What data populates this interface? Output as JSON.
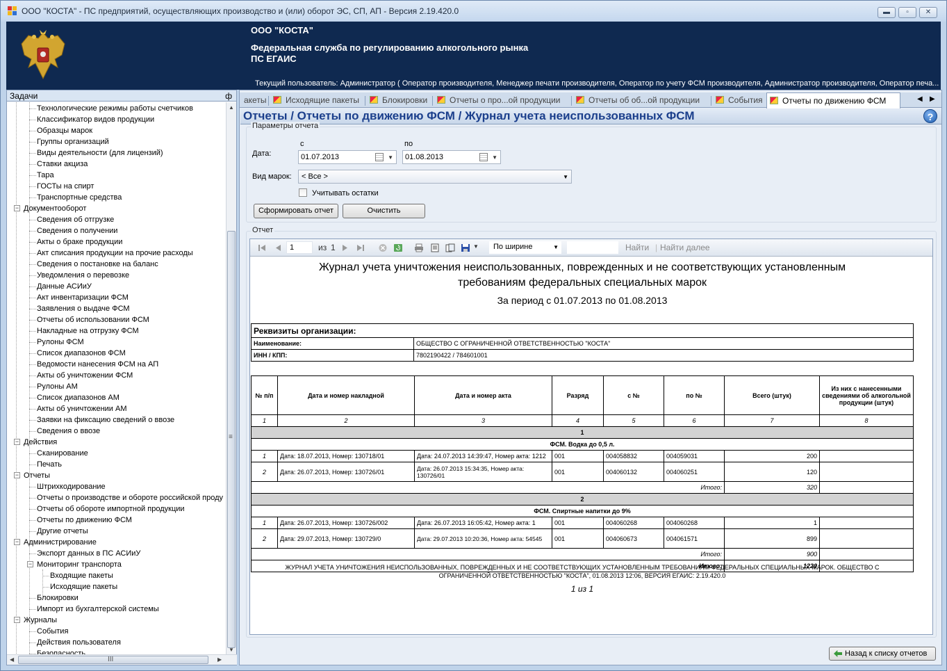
{
  "window": {
    "title": "ООО \"КОСТА\" - ПС предприятий, осуществляющих производство и (или) оборот ЭС, СП, АП - Версия 2.19.420.0",
    "controls": {
      "minimize": "▬",
      "maximize": "▫",
      "close": "✕"
    }
  },
  "banner": {
    "company": "ООО \"КОСТА\"",
    "service": "Федеральная служба по регулированию алкогольного рынка",
    "system": "ПС ЕГАИС",
    "current_user": "Текущий пользователь: Администратор ( Оператор производителя, Менеджер печати производителя, Оператор по учету ФСМ производителя, Администратор производителя, Оператор печа..."
  },
  "tasks_panel": {
    "title": "Задачи",
    "pin": "ф",
    "items": [
      {
        "label": "Технологические режимы работы счетчиков",
        "level": 2
      },
      {
        "label": "Классификатор видов продукции",
        "level": 2
      },
      {
        "label": "Образцы марок",
        "level": 2
      },
      {
        "label": "Группы организаций",
        "level": 2
      },
      {
        "label": "Виды деятельности (для лицензий)",
        "level": 2
      },
      {
        "label": "Ставки акциза",
        "level": 2
      },
      {
        "label": "Тара",
        "level": 2
      },
      {
        "label": "ГОСТы на спирт",
        "level": 2
      },
      {
        "label": "Транспортные средства",
        "level": 2
      },
      {
        "label": "Документооборот",
        "level": 1,
        "toggle": "−"
      },
      {
        "label": "Сведения об отгрузке",
        "level": 2
      },
      {
        "label": "Сведения о получении",
        "level": 2
      },
      {
        "label": "Акты о браке продукции",
        "level": 2
      },
      {
        "label": "Акт списания продукции на прочие расходы",
        "level": 2
      },
      {
        "label": "Сведения о постановке на баланс",
        "level": 2
      },
      {
        "label": "Уведомления о перевозке",
        "level": 2
      },
      {
        "label": "Данные АСИиУ",
        "level": 2
      },
      {
        "label": "Акт инвентаризации ФСМ",
        "level": 2
      },
      {
        "label": "Заявления о выдаче ФСМ",
        "level": 2
      },
      {
        "label": "Отчеты об использовании ФСМ",
        "level": 2
      },
      {
        "label": "Накладные на отгрузку ФСМ",
        "level": 2
      },
      {
        "label": "Рулоны ФСМ",
        "level": 2
      },
      {
        "label": "Список диапазонов ФСМ",
        "level": 2
      },
      {
        "label": "Ведомости нанесения ФСМ на АП",
        "level": 2
      },
      {
        "label": "Акты об уничтожении ФСМ",
        "level": 2
      },
      {
        "label": "Рулоны АМ",
        "level": 2
      },
      {
        "label": "Список диапазонов АМ",
        "level": 2
      },
      {
        "label": "Акты об уничтожении АМ",
        "level": 2
      },
      {
        "label": "Заявки на фиксацию сведений о ввозе",
        "level": 2
      },
      {
        "label": "Сведения о ввозе",
        "level": 2
      },
      {
        "label": "Действия",
        "level": 1,
        "toggle": "−"
      },
      {
        "label": "Сканирование",
        "level": 2
      },
      {
        "label": "Печать",
        "level": 2
      },
      {
        "label": "Отчеты",
        "level": 1,
        "toggle": "−"
      },
      {
        "label": "Штрихкодирование",
        "level": 2
      },
      {
        "label": "Отчеты о производстве и обороте российской проду",
        "level": 2
      },
      {
        "label": "Отчеты об обороте импортной продукции",
        "level": 2
      },
      {
        "label": "Отчеты по движению ФСМ",
        "level": 2
      },
      {
        "label": "Другие отчеты",
        "level": 2
      },
      {
        "label": "Администрирование",
        "level": 1,
        "toggle": "−"
      },
      {
        "label": "Экспорт данных в ПС АСИиУ",
        "level": 2
      },
      {
        "label": "Мониторинг транспорта",
        "level": 2,
        "toggle": "−"
      },
      {
        "label": "Входящие пакеты",
        "level": 3
      },
      {
        "label": "Исходящие пакеты",
        "level": 3
      },
      {
        "label": "Блокировки",
        "level": 2
      },
      {
        "label": "Импорт из бухгалтерской системы",
        "level": 2
      },
      {
        "label": "Журналы",
        "level": 1,
        "toggle": "−"
      },
      {
        "label": "События",
        "level": 2
      },
      {
        "label": "Действия пользователя",
        "level": 2
      },
      {
        "label": "Безопасность",
        "level": 2
      }
    ],
    "hscroll_grip": "III",
    "vscroll_grip": "≡"
  },
  "tabs": [
    {
      "label": "акеты",
      "icon": false
    },
    {
      "label": "Исходящие пакеты",
      "icon": true
    },
    {
      "label": "Блокировки",
      "icon": true
    },
    {
      "label": "Отчеты о про...ой продукции",
      "icon": true
    },
    {
      "label": "Отчеты об об...ой продукции",
      "icon": true
    },
    {
      "label": "События",
      "icon": true
    },
    {
      "label": "Отчеты по движению ФСМ",
      "icon": true,
      "active": true
    }
  ],
  "tab_nav": {
    "prev": "◀",
    "next": "▶"
  },
  "heading": {
    "title": "Отчеты / Отчеты по движению ФСМ / Журнал учета неиспользованных ФСМ",
    "help": "?"
  },
  "params": {
    "legend": "Параметры отчета",
    "date_label": "Дата:",
    "from_label": "с",
    "to_label": "по",
    "from_value": "01.07.2013",
    "to_value": "01.08.2013",
    "mark_type_label": "Вид марок:",
    "mark_type_value": "< Все >",
    "include_balance_label": "Учитывать остатки",
    "generate_button": "Сформировать отчет",
    "clear_button": "Очистить"
  },
  "report": {
    "legend": "Отчет",
    "toolbar": {
      "page_value": "1",
      "page_of": "из",
      "page_total": "1",
      "zoom_value": "По ширине",
      "find": "Найти",
      "find_next": "Найти далее"
    },
    "doc": {
      "title_line1": "Журнал учета уничтожения неиспользованных, поврежденных и не соответствующих установленным",
      "title_line2": "требованиям федеральных специальных марок",
      "period": "За период с 01.07.2013 по 01.08.2013",
      "org_header": "Реквизиты организации:",
      "name_label": "Наименование:",
      "name_value": "ОБЩЕСТВО С ОГРАНИЧЕННОЙ ОТВЕТСТВЕННОСТЬЮ \"КОСТА\"",
      "inn_label": "ИНН /  КПП:",
      "inn_value": "7802190422  /  784601001",
      "columns": [
        "№ п/п",
        "Дата и номер накладной",
        "Дата и номер акта",
        "Разряд",
        "с №",
        "по №",
        "Всего (штук)",
        "Из них с нанесенными сведениями об алкогольной продукции (штук)"
      ],
      "column_numbers": [
        "1",
        "2",
        "3",
        "4",
        "5",
        "6",
        "7",
        "8"
      ],
      "groups": [
        {
          "rank": "1",
          "category": "ФСМ. Водка до 0,5 л.",
          "rows": [
            {
              "n": "1",
              "invoice": "Дата: 18.07.2013, Номер: 130718/01",
              "act": "Дата: 24.07.2013 14:39:47, Номер акта: 1212",
              "grade": "001",
              "from": "004058832",
              "to": "004059031",
              "total": "200",
              "applied": ""
            },
            {
              "n": "2",
              "invoice": "Дата: 26.07.2013, Номер: 130726/01",
              "act": "Дата: 26.07.2013 15:34:35, Номер акта: 130726/01",
              "grade": "001",
              "from": "004060132",
              "to": "004060251",
              "total": "120",
              "applied": ""
            }
          ],
          "subtotal_label": "Итого:",
          "subtotal": "320"
        },
        {
          "rank": "2",
          "category": "ФСМ. Спиртные напитки до 9%",
          "rows": [
            {
              "n": "1",
              "invoice": "Дата: 26.07.2013, Номер: 130726/002",
              "act": "Дата: 26.07.2013 16:05:42, Номер акта: 1",
              "grade": "001",
              "from": "004060268",
              "to": "004060268",
              "total": "1",
              "applied": ""
            },
            {
              "n": "2",
              "invoice": "Дата: 29.07.2013, Номер: 130729/0",
              "act": "Дата: 29.07.2013 10:20:36, Номер акта: 54545",
              "grade": "001",
              "from": "004060673",
              "to": "004061571",
              "total": "899",
              "applied": ""
            }
          ],
          "subtotal_label": "Итого:",
          "subtotal": "900"
        }
      ],
      "grand_total_label": "Итого:",
      "grand_total": "1220",
      "footer_line1": "ЖУРНАЛ УЧЕТА УНИЧТОЖЕНИЯ НЕИСПОЛЬЗОВАННЫХ, ПОВРЕЖДЕННЫХ И НЕ СООТВЕТСТВУЮЩИХ УСТАНОВЛЕННЫМ ТРЕБОВАНИЯМ ФЕДЕРАЛЬНЫХ СПЕЦИАЛЬНЫХ МАРОК. ОБЩЕСТВО С",
      "footer_line2": "ОГРАНИЧЕННОЙ ОТВЕТСТВЕННОСТЬЮ \"КОСТА\", 01.08.2013 12:06, ВЕРСИЯ ЕГАИС: 2.19.420.0",
      "page_info": "1 из 1"
    }
  },
  "back_button": "Назад к списку отчетов",
  "colors": {
    "banner": "#0f2950",
    "heading_text": "#1b3f8c",
    "window_frame": "#bfd3ea"
  }
}
